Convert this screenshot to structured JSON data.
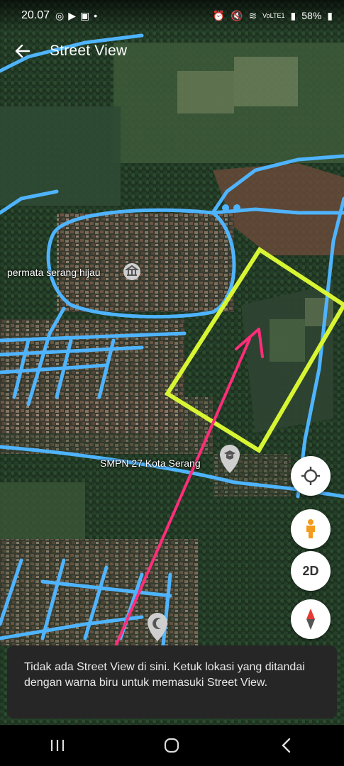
{
  "status": {
    "time": "20.07",
    "left_icons": [
      "whatsapp-icon",
      "youtube-icon",
      "gallery-icon",
      "dot-icon"
    ],
    "network": "VoLTE1",
    "battery": "58%"
  },
  "appbar": {
    "title": "Street View"
  },
  "map": {
    "places": [
      {
        "name": "permata serang hijau",
        "icon": "landmark-icon"
      },
      {
        "name": "SMPN 27 Kota Serang",
        "icon": "school-icon"
      },
      {
        "name": "",
        "icon": "mosque-icon"
      }
    ]
  },
  "controls": {
    "location": "my-location-icon",
    "pegman": "pegman-icon",
    "view_mode": "2D",
    "compass": "compass-icon"
  },
  "snackbar": {
    "message": "Tidak ada Street View di sini. Ketuk lokasi yang ditandai dengan warna biru untuk memasuki Street View."
  },
  "annotations": {
    "highlight_color": "#d7f532",
    "arrow_color": "#ff2d7a",
    "road_color": "#4fb4ff"
  }
}
